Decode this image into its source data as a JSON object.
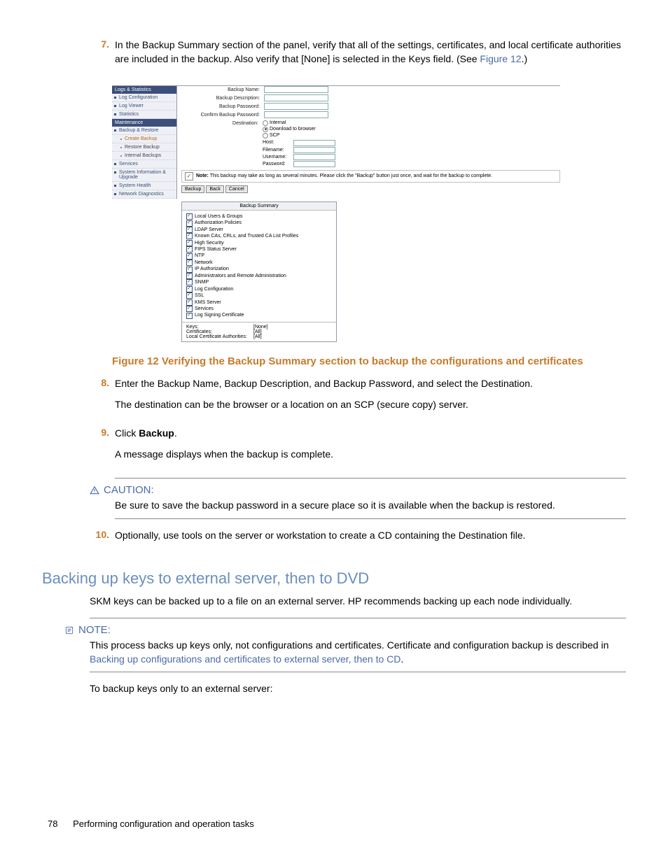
{
  "step7": {
    "num": "7.",
    "text1": "In the Backup Summary section of the panel, verify that all of the settings, certificates, and local certificate authorities are included in the backup. Also verify that [None] is selected in the Keys field. (See ",
    "link": "Figure 12",
    "text2": ".)"
  },
  "screenshot": {
    "sidebar": {
      "hdr1": "Logs & Statistics",
      "items1": [
        "Log Configuration",
        "Log Viewer",
        "Statistics"
      ],
      "hdr2": "Maintenance",
      "items2": [
        {
          "label": "Backup & Restore",
          "sub": false,
          "sel": false
        },
        {
          "label": "Create Backup",
          "sub": true,
          "sel": true
        },
        {
          "label": "Restore Backup",
          "sub": true,
          "sel": false
        },
        {
          "label": "Internal Backups",
          "sub": true,
          "sel": false
        },
        {
          "label": "Services",
          "sub": false,
          "sel": false
        },
        {
          "label": "System Information & Upgrade",
          "sub": false,
          "sel": false
        },
        {
          "label": "System Health",
          "sub": false,
          "sel": false
        },
        {
          "label": "Network Diagnostics",
          "sub": false,
          "sel": false
        }
      ]
    },
    "form": {
      "rows": [
        {
          "label": "Backup Name:",
          "input": true
        },
        {
          "label": "Backup Description:",
          "input": true
        },
        {
          "label": "Backup Password:",
          "input": true
        },
        {
          "label": "Confirm Backup Password:",
          "input": true
        }
      ],
      "destLabel": "Destination:",
      "destOpts": [
        "Internal",
        "Download to browser",
        "SCP"
      ],
      "destSel": 1,
      "subrows": [
        {
          "label": "Host:"
        },
        {
          "label": "Filename:"
        },
        {
          "label": "Username:"
        },
        {
          "label": "Password:"
        }
      ],
      "noteLabel": "Note:",
      "noteText": "This backup may take as long as several minutes. Please click the \"Backup\" button just once, and wait for the backup to complete.",
      "buttons": [
        "Backup",
        "Back",
        "Cancel"
      ]
    },
    "summary": {
      "header": "Backup Summary",
      "items": [
        "Local Users & Groups",
        "Authorization Policies",
        "LDAP Server",
        "Known CAs, CRLs, and Trusted CA List Profiles",
        "High Security",
        "FIPS Status Server",
        "NTP",
        "Network",
        "IP Authorization",
        "Administrators and Remote Administration",
        "SNMP",
        "Log Configuration",
        "SSL",
        "KMS Server",
        "Services",
        "Log Signing Certificate"
      ],
      "footer": [
        {
          "k": "Keys:",
          "v": "[None]"
        },
        {
          "k": "Certificates:",
          "v": "[All]"
        },
        {
          "k": "Local Certificate Authorities:",
          "v": "[All]"
        }
      ]
    }
  },
  "figureCaption": "Figure 12 Verifying the Backup Summary section to backup the configurations and certificates",
  "step8": {
    "num": "8.",
    "p1": "Enter the Backup Name, Backup Description, and Backup Password, and select the Destination.",
    "p2": "The destination can be the browser or a location on an SCP (secure copy) server."
  },
  "step9": {
    "num": "9.",
    "p1a": "Click ",
    "p1b": "Backup",
    "p1c": ".",
    "p2": "A message displays when the backup is complete."
  },
  "caution": {
    "label": "CAUTION:",
    "body": "Be sure to save the backup password in a secure place so it is available when the backup is restored."
  },
  "step10": {
    "num": "10.",
    "p1": "Optionally, use tools on the server or workstation to create a CD containing the Destination file."
  },
  "h2": "Backing up keys to external server, then to DVD",
  "afterH2": "SKM keys can be backed up to a file on an external server. HP recommends backing up each node individually.",
  "note": {
    "label": "NOTE:",
    "body1": "This process backs up keys only, not configurations and certificates. Certificate and configuration backup is described in ",
    "link": "Backing up configurations and certificates to external server, then to CD",
    "body2": "."
  },
  "afterNote": "To backup keys only to an external server:",
  "footer": {
    "page": "78",
    "section": "Performing configuration and operation tasks"
  }
}
